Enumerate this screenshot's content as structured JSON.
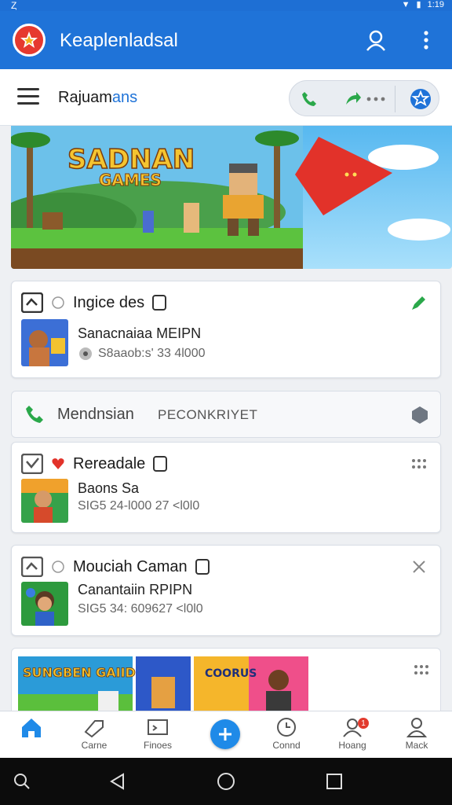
{
  "status_bar": {
    "left_glyph": "Ȥ",
    "time": "1:19"
  },
  "app_bar": {
    "title": "Keaplenladsal",
    "icons": [
      "app-logo-icon",
      "account-icon",
      "more-vert-icon"
    ]
  },
  "toolbar": {
    "title_main": "Rajuam",
    "title_accent": "ans",
    "pill_icons": [
      "phone-icon",
      "share-icon",
      "more-dots-icon",
      "star-badge-icon"
    ]
  },
  "banner": {
    "title_line1": "SADNAN",
    "title_line2": "GAMES"
  },
  "cards": [
    {
      "title": "Ingice des",
      "name": "Sanacnaiaa MEIPN",
      "meta": "S8aaob:s' 33 4l000",
      "action": "edit-icon"
    },
    {
      "title": "Rereadale",
      "name": "Baons Sa",
      "meta": "SIG5 24-l000 27 <l0l0",
      "action": "more-dots-icon"
    },
    {
      "title": "Mouciah Caman",
      "name": "Canantaiin RPIPN",
      "meta": "SIG5 34: 609627 <l0l0",
      "action": "close-icon"
    }
  ],
  "mode_row": {
    "label": "Mendnsian",
    "value": "PECONKRIYET"
  },
  "gallery": {
    "title_text": "SUNGBEN GAIID",
    "card2_text": "COORUS"
  },
  "bottom_nav": {
    "items": [
      {
        "label": "",
        "icon": "home-icon"
      },
      {
        "label": "Carne",
        "icon": "tag-icon"
      },
      {
        "label": "Finoes",
        "icon": "screen-icon"
      },
      {
        "label": "",
        "icon": "add-icon"
      },
      {
        "label": "Connd",
        "icon": "clock-icon"
      },
      {
        "label": "Hoang",
        "icon": "profile-icon"
      },
      {
        "label": "Mack",
        "icon": "person-icon"
      }
    ],
    "badge": "1"
  },
  "colors": {
    "primary": "#1f73d8",
    "accent_red": "#e6392f",
    "green": "#2aa84a"
  }
}
